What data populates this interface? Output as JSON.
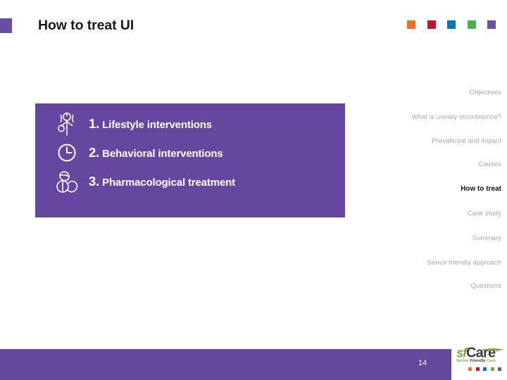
{
  "slide": {
    "title": "How to treat UI",
    "page_number": "14",
    "accent_color": "#6a4fa3",
    "panel_color": "#65479f"
  },
  "top_chips": [
    {
      "name": "chip-orange",
      "color": "#ec7024"
    },
    {
      "name": "chip-red",
      "color": "#c41230"
    },
    {
      "name": "chip-blue",
      "color": "#0076b6"
    },
    {
      "name": "chip-green",
      "color": "#4caf50"
    },
    {
      "name": "chip-purple",
      "color": "#6a4fa3"
    }
  ],
  "panel": {
    "items": [
      {
        "icon": "exercise-person-icon",
        "number": "1.",
        "label": "Lifestyle interventions"
      },
      {
        "icon": "clock-icon",
        "number": "2.",
        "label": "Behavioral interventions"
      },
      {
        "icon": "pills-icon",
        "number": "3.",
        "label": "Pharmacological treatment"
      }
    ]
  },
  "nav": {
    "items": [
      {
        "label": "Objectives",
        "active": false
      },
      {
        "label": "What is urinary incontinence?",
        "active": false
      },
      {
        "label": "Prevalence and impact",
        "active": false
      },
      {
        "label": "Causes",
        "active": false
      },
      {
        "label": "How to treat",
        "active": true
      },
      {
        "label": "Case study",
        "active": false
      },
      {
        "label": "Summary",
        "active": false
      },
      {
        "label": "Senior friendly approach",
        "active": false
      },
      {
        "label": "Questions",
        "active": false
      }
    ]
  },
  "logo": {
    "sf": "sf",
    "care": "Care",
    "tm": "™",
    "tagline_senior": "Senior",
    "tagline_rest": " Friendly ",
    "tagline_care": "Care",
    "tagline_full": "Senior Friendly Care",
    "chips": [
      {
        "name": "logo-chip-orange",
        "color": "#ec7024"
      },
      {
        "name": "logo-chip-red",
        "color": "#c41230"
      },
      {
        "name": "logo-chip-blue",
        "color": "#0076b6"
      },
      {
        "name": "logo-chip-green",
        "color": "#76a940"
      },
      {
        "name": "logo-chip-purple",
        "color": "#6a4fa3"
      }
    ]
  }
}
